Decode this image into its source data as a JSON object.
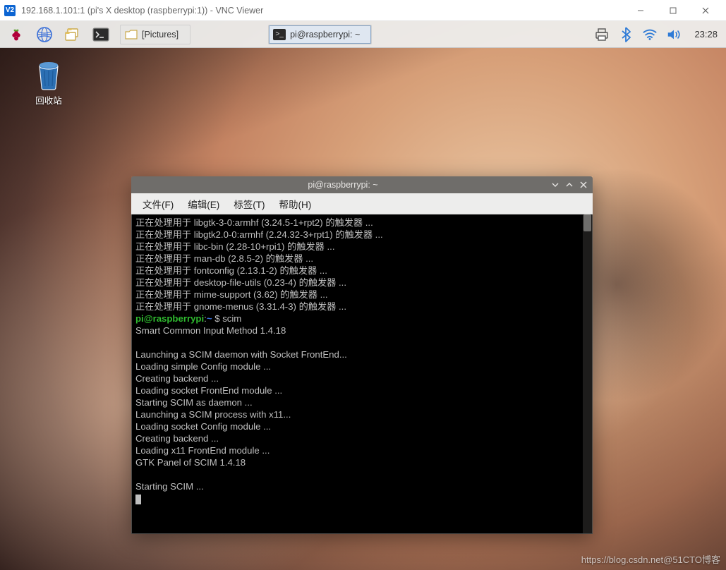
{
  "vnc": {
    "title": "192.168.1.101:1 (pi's X desktop (raspberrypi:1)) - VNC Viewer",
    "icon_text": "V2"
  },
  "panel": {
    "task_buttons": [
      {
        "icon": "folder",
        "label": "[Pictures]"
      },
      {
        "icon": "terminal",
        "label": "pi@raspberrypi: ~"
      }
    ],
    "clock": "23:28"
  },
  "desktop": {
    "trash_label": "回收站"
  },
  "terminal": {
    "title": "pi@raspberrypi: ~",
    "menu": {
      "file": "文件(F)",
      "edit": "编辑(E)",
      "tabs": "标签(T)",
      "help": "帮助(H)"
    },
    "prompt_user": "pi@raspberrypi",
    "prompt_path": "~",
    "prompt_symbol": "$",
    "command": "scim",
    "lines_before": [
      "正在处理用于 libgtk-3-0:armhf (3.24.5-1+rpt2) 的触发器 ...",
      "正在处理用于 libgtk2.0-0:armhf (2.24.32-3+rpt1) 的触发器 ...",
      "正在处理用于 libc-bin (2.28-10+rpi1) 的触发器 ...",
      "正在处理用于 man-db (2.8.5-2) 的触发器 ...",
      "正在处理用于 fontconfig (2.13.1-2) 的触发器 ...",
      "正在处理用于 desktop-file-utils (0.23-4) 的触发器 ...",
      "正在处理用于 mime-support (3.62) 的触发器 ...",
      "正在处理用于 gnome-menus (3.31.4-3) 的触发器 ..."
    ],
    "lines_after": [
      "Smart Common Input Method 1.4.18",
      "",
      "Launching a SCIM daemon with Socket FrontEnd...",
      "Loading simple Config module ...",
      "Creating backend ...",
      "Loading socket FrontEnd module ...",
      "Starting SCIM as daemon ...",
      "Launching a SCIM process with x11...",
      "Loading socket Config module ...",
      "Creating backend ...",
      "Loading x11 FrontEnd module ...",
      "GTK Panel of SCIM 1.4.18",
      "",
      "Starting SCIM ..."
    ]
  },
  "watermark": "https://blog.csdn.net@51CTO博客"
}
